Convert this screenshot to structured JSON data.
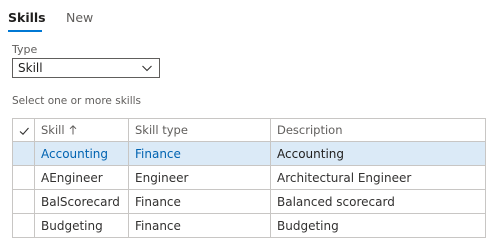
{
  "tabs": [
    {
      "label": "Skills",
      "active": true
    },
    {
      "label": "New",
      "active": false
    }
  ],
  "type_field": {
    "label": "Type",
    "value": "Skill"
  },
  "hint": "Select one or more skills",
  "grid": {
    "columns": [
      "Skill",
      "Skill type",
      "Description"
    ],
    "sort_icon": "arrow-up-icon",
    "rows": [
      {
        "skill": "Accounting",
        "type": "Finance",
        "description": "Accounting",
        "selected": true
      },
      {
        "skill": "AEngineer",
        "type": "Engineer",
        "description": "Architectural Engineer",
        "selected": false
      },
      {
        "skill": "BalScorecard",
        "type": "Finance",
        "description": "Balanced scorecard",
        "selected": false
      },
      {
        "skill": "Budgeting",
        "type": "Finance",
        "description": "Budgeting",
        "selected": false
      }
    ]
  },
  "colors": {
    "accent": "#0078d4",
    "selected_row": "#dbeaf7",
    "selected_text": "#0063b1"
  }
}
